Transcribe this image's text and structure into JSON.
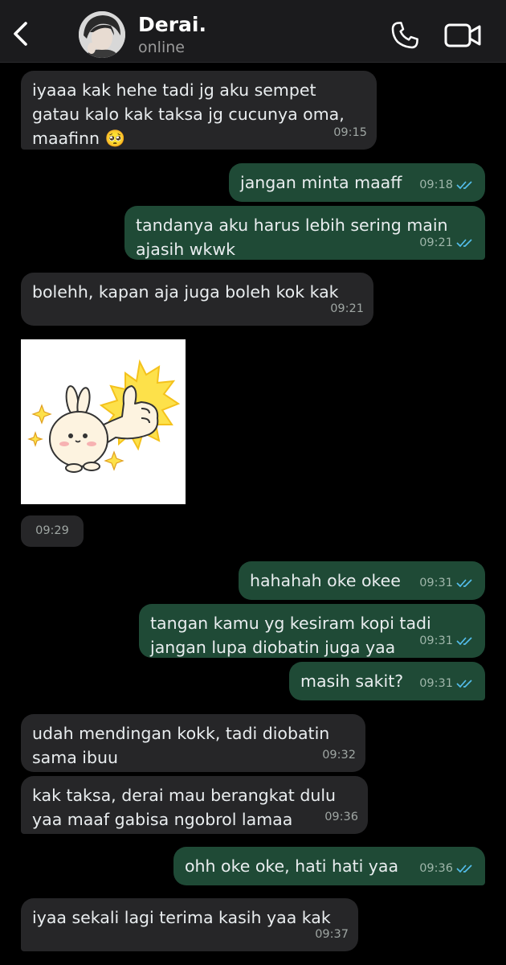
{
  "header": {
    "back_icon": "chevron-left-icon",
    "contact_name": "Derai.",
    "status": "online",
    "call_icon": "phone-icon",
    "video_icon": "video-camera-icon"
  },
  "colors": {
    "background": "#000000",
    "header": "#1b1b1d",
    "incoming_bubble": "#262628",
    "outgoing_bubble": "#1f4a36",
    "read_tick": "#53bdeb"
  },
  "messages": [
    {
      "dir": "in",
      "text": "iyaaa kak hehe tadi jg aku sempet\ngatau kalo kak taksa jg cucunya oma,\nmaafinn 🥺",
      "time": "09:15"
    },
    {
      "dir": "out",
      "text": "jangan minta maaff",
      "time": "09:18",
      "status": "read"
    },
    {
      "dir": "out",
      "text": "tandanya aku harus lebih sering main\najasih wkwk",
      "time": "09:21",
      "status": "read"
    },
    {
      "dir": "in",
      "text": "bolehh, kapan aja juga boleh kok kak",
      "time": "09:21"
    },
    {
      "dir": "in",
      "type": "sticker",
      "sticker": "bunny-thumbs-up-sticker",
      "time": "09:29"
    },
    {
      "dir": "out",
      "text": "hahahah oke okee",
      "time": "09:31",
      "status": "read"
    },
    {
      "dir": "out",
      "text": "tangan kamu yg kesiram kopi tadi\njangan lupa diobatin juga yaa",
      "time": "09:31",
      "status": "read"
    },
    {
      "dir": "out",
      "text": "masih sakit?",
      "time": "09:31",
      "status": "read"
    },
    {
      "dir": "in",
      "text": "udah mendingan kokk, tadi diobatin\nsama ibuu",
      "time": "09:32"
    },
    {
      "dir": "in",
      "text": "kak taksa, derai mau berangkat dulu\nyaa maaf gabisa ngobrol lamaa",
      "time": "09:36"
    },
    {
      "dir": "out",
      "text": "ohh oke oke, hati hati yaa",
      "time": "09:36",
      "status": "read"
    },
    {
      "dir": "in",
      "text": "iyaa sekali lagi terima kasih yaa kak",
      "time": "09:37"
    }
  ]
}
